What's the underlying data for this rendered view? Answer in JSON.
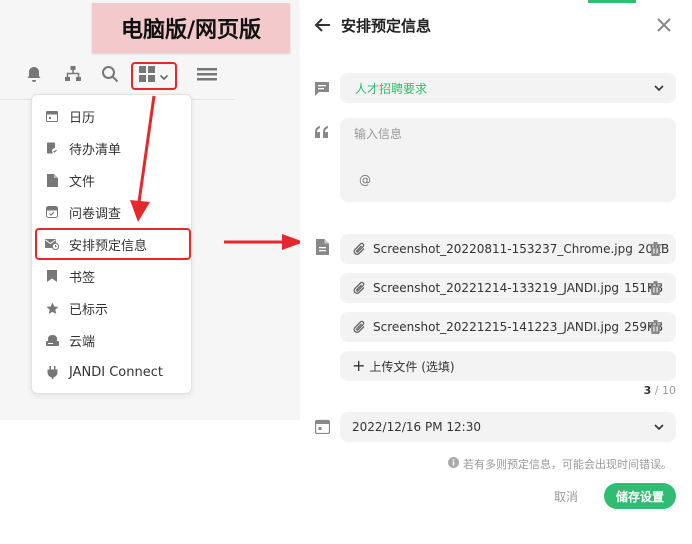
{
  "banner": {
    "text": "电脑版/网页版"
  },
  "toolbar": {
    "icons": [
      "bell-icon",
      "org-chart-icon",
      "search-icon",
      "apps-grid-icon",
      "chevron-down-icon",
      "hamburger-menu-icon"
    ]
  },
  "menu": {
    "items": [
      {
        "label": "日历",
        "icon": "calendar-icon"
      },
      {
        "label": "待办清单",
        "icon": "todo-icon"
      },
      {
        "label": "文件",
        "icon": "file-icon"
      },
      {
        "label": "问卷调查",
        "icon": "poll-icon"
      },
      {
        "label": "安排预定信息",
        "icon": "schedule-message-icon",
        "highlighted": true
      },
      {
        "label": "书签",
        "icon": "bookmark-icon"
      },
      {
        "label": "已标示",
        "icon": "star-icon"
      },
      {
        "label": "云端",
        "icon": "cloud-drive-icon"
      },
      {
        "label": "JANDI Connect",
        "icon": "plug-icon"
      }
    ]
  },
  "panel": {
    "title": "安排预定信息",
    "topic_select": {
      "value": "人才招聘要求"
    },
    "message": {
      "placeholder": "输入信息",
      "mention": "@"
    },
    "files": [
      {
        "name": "Screenshot_20220811-153237_Chrome.jpg",
        "size": "20KB"
      },
      {
        "name": "Screenshot_20221214-133219_JANDI.jpg",
        "size": "151KB"
      },
      {
        "name": "Screenshot_20221215-141223_JANDI.jpg",
        "size": "259KB"
      }
    ],
    "upload_label": "上传文件 (选填)",
    "file_count": {
      "current": "3",
      "separator": " / ",
      "max": "10"
    },
    "schedule_datetime": "2022/12/16 PM 12:30",
    "notice": "若有多则预定信息，可能会出现时间错误。",
    "cancel_label": "取消",
    "save_label": "储存设置"
  },
  "colors": {
    "accent_green": "#2ebd72",
    "highlight_red": "#e5282b",
    "banner_pink": "#f4c9cb"
  }
}
